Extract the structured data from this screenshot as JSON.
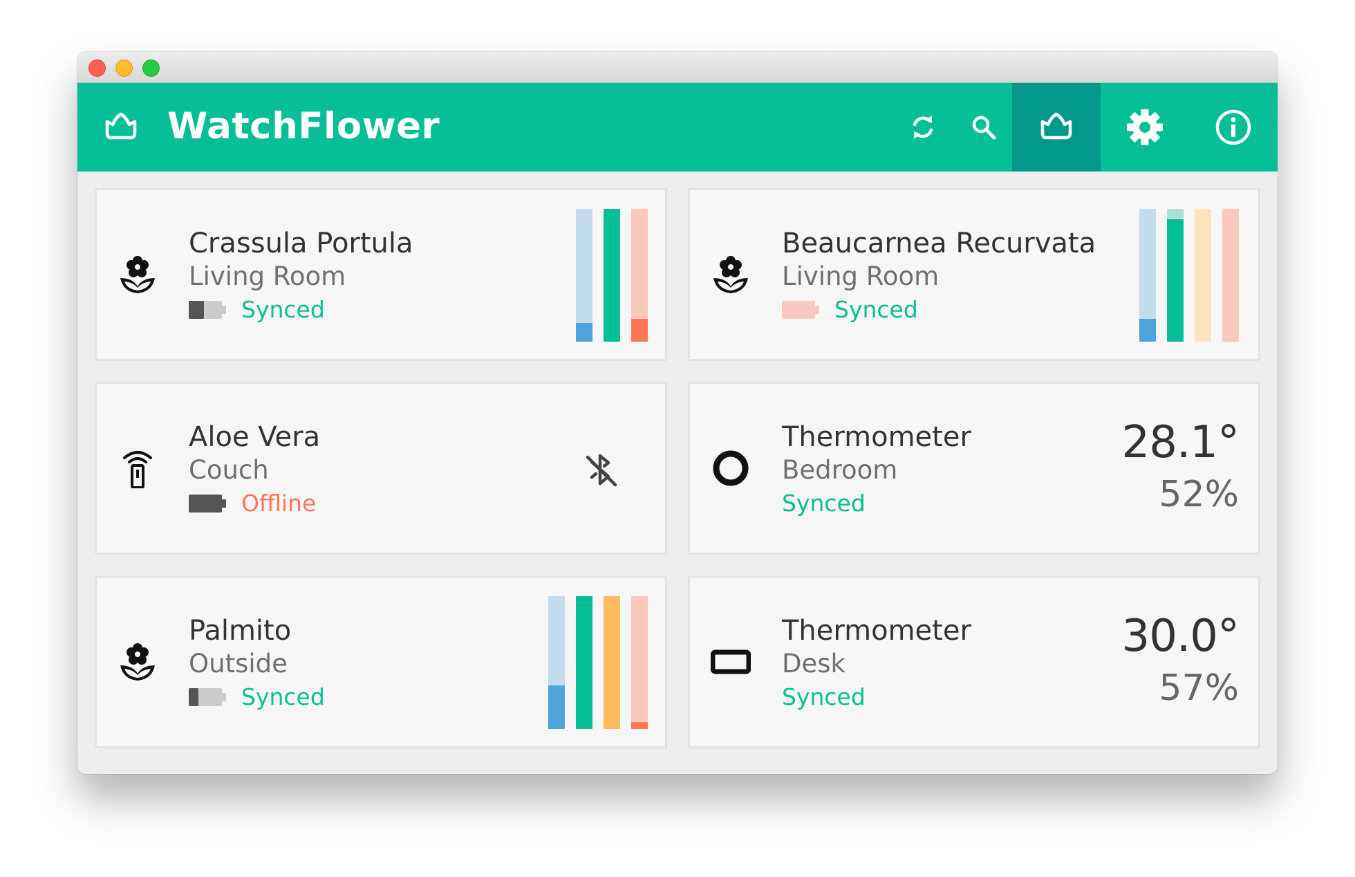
{
  "app": {
    "title": "WatchFlower"
  },
  "toolbar": {
    "refresh_icon": "refresh-icon",
    "search_icon": "search-icon",
    "devices_icon": "flower-outline-icon",
    "settings_icon": "gear-icon",
    "about_icon": "info-icon"
  },
  "colors": {
    "primary": "#07bf96",
    "primary_dark": "#03998a",
    "water": "#4fa3da",
    "water_bg": "#c3dcec",
    "fertility": "#07bf96",
    "fertility_bg": "#a9e3d6",
    "light": "#ffbc5b",
    "light_bg": "#fbe3c0",
    "temperature": "#ff7657",
    "temperature_bg": "#f9c9bd",
    "synced": "#07bf96",
    "offline": "#ff7657"
  },
  "devices": [
    {
      "name": "Crassula Portula",
      "location": "Living Room",
      "status": "Synced",
      "icon": "flower-icon",
      "battery_level": 0.45,
      "bars": [
        {
          "type": "water",
          "level": 0.14
        },
        {
          "type": "fertility",
          "level": 1.0
        },
        {
          "type": "temperature",
          "level": 0.17
        }
      ]
    },
    {
      "name": "Beaucarnea Recurvata",
      "location": "Living Room",
      "status": "Synced",
      "icon": "flower-icon",
      "battery_level": 0.0,
      "bars": [
        {
          "type": "water",
          "level": 0.17
        },
        {
          "type": "fertility",
          "level": 0.92
        },
        {
          "type": "light",
          "level": 0.0
        },
        {
          "type": "temperature",
          "level": 0.0
        }
      ]
    },
    {
      "name": "Aloe Vera",
      "location": "Couch",
      "status": "Offline",
      "icon": "remote-sensor-icon",
      "battery_level": 1.0,
      "extra_icon": "bluetooth-off-icon"
    },
    {
      "name": "Thermometer",
      "location": "Bedroom",
      "status": "Synced",
      "icon": "round-thermometer-icon",
      "temperature": "28.1°",
      "humidity": "52%"
    },
    {
      "name": "Palmito",
      "location": "Outside",
      "status": "Synced",
      "icon": "flower-icon",
      "battery_level": 0.3,
      "bars": [
        {
          "type": "water",
          "level": 0.33
        },
        {
          "type": "fertility",
          "level": 1.0
        },
        {
          "type": "light",
          "level": 1.0
        },
        {
          "type": "temperature",
          "level": 0.05
        }
      ]
    },
    {
      "name": "Thermometer",
      "location": "Desk",
      "status": "Synced",
      "icon": "rectangle-thermometer-icon",
      "temperature": "30.0°",
      "humidity": "57%"
    }
  ]
}
